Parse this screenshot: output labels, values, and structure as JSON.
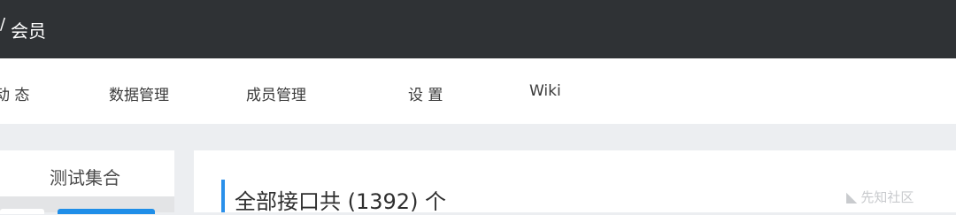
{
  "topbar": {
    "title": "会员"
  },
  "nav": {
    "items": [
      {
        "label": "动 态"
      },
      {
        "label": "数据管理"
      },
      {
        "label": "成员管理"
      },
      {
        "label": "设 置"
      },
      {
        "label": "Wiki"
      }
    ]
  },
  "sidebar": {
    "title": "测试集合"
  },
  "main": {
    "heading": "全部接口共 (1392) 个"
  },
  "watermark": {
    "text": "先知社区"
  },
  "colors": {
    "topbar_bg": "#2f3235",
    "accent": "#2a90ea",
    "active_tab": "#1f8ee8",
    "page_bg": "#eceef1"
  },
  "icons": {
    "back": "slash-icon",
    "watermark": "xianzhi-logo-icon"
  }
}
